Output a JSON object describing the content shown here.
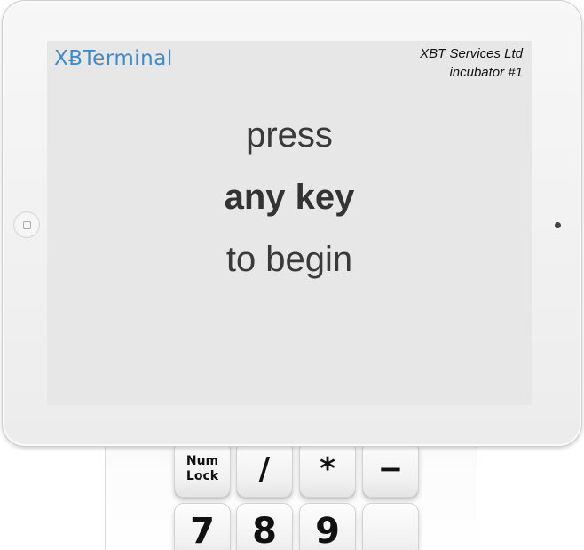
{
  "screen": {
    "logo": "XɃTerminal",
    "company_line1": "XBT Services Ltd",
    "company_line2": "incubator #1",
    "prompt_line1": "press",
    "prompt_line2": "any key",
    "prompt_line3": "to begin"
  },
  "keypad": {
    "keys": [
      "Num\nLock",
      "/",
      "*",
      "−",
      "7",
      "8",
      "9",
      ""
    ]
  },
  "colors": {
    "logo_accent": "#3f8bc9",
    "screen_bg": "#e7e7e7",
    "text": "#3a3a3a"
  },
  "icons": {
    "home_button": "home-button-icon",
    "camera": "camera-icon"
  }
}
